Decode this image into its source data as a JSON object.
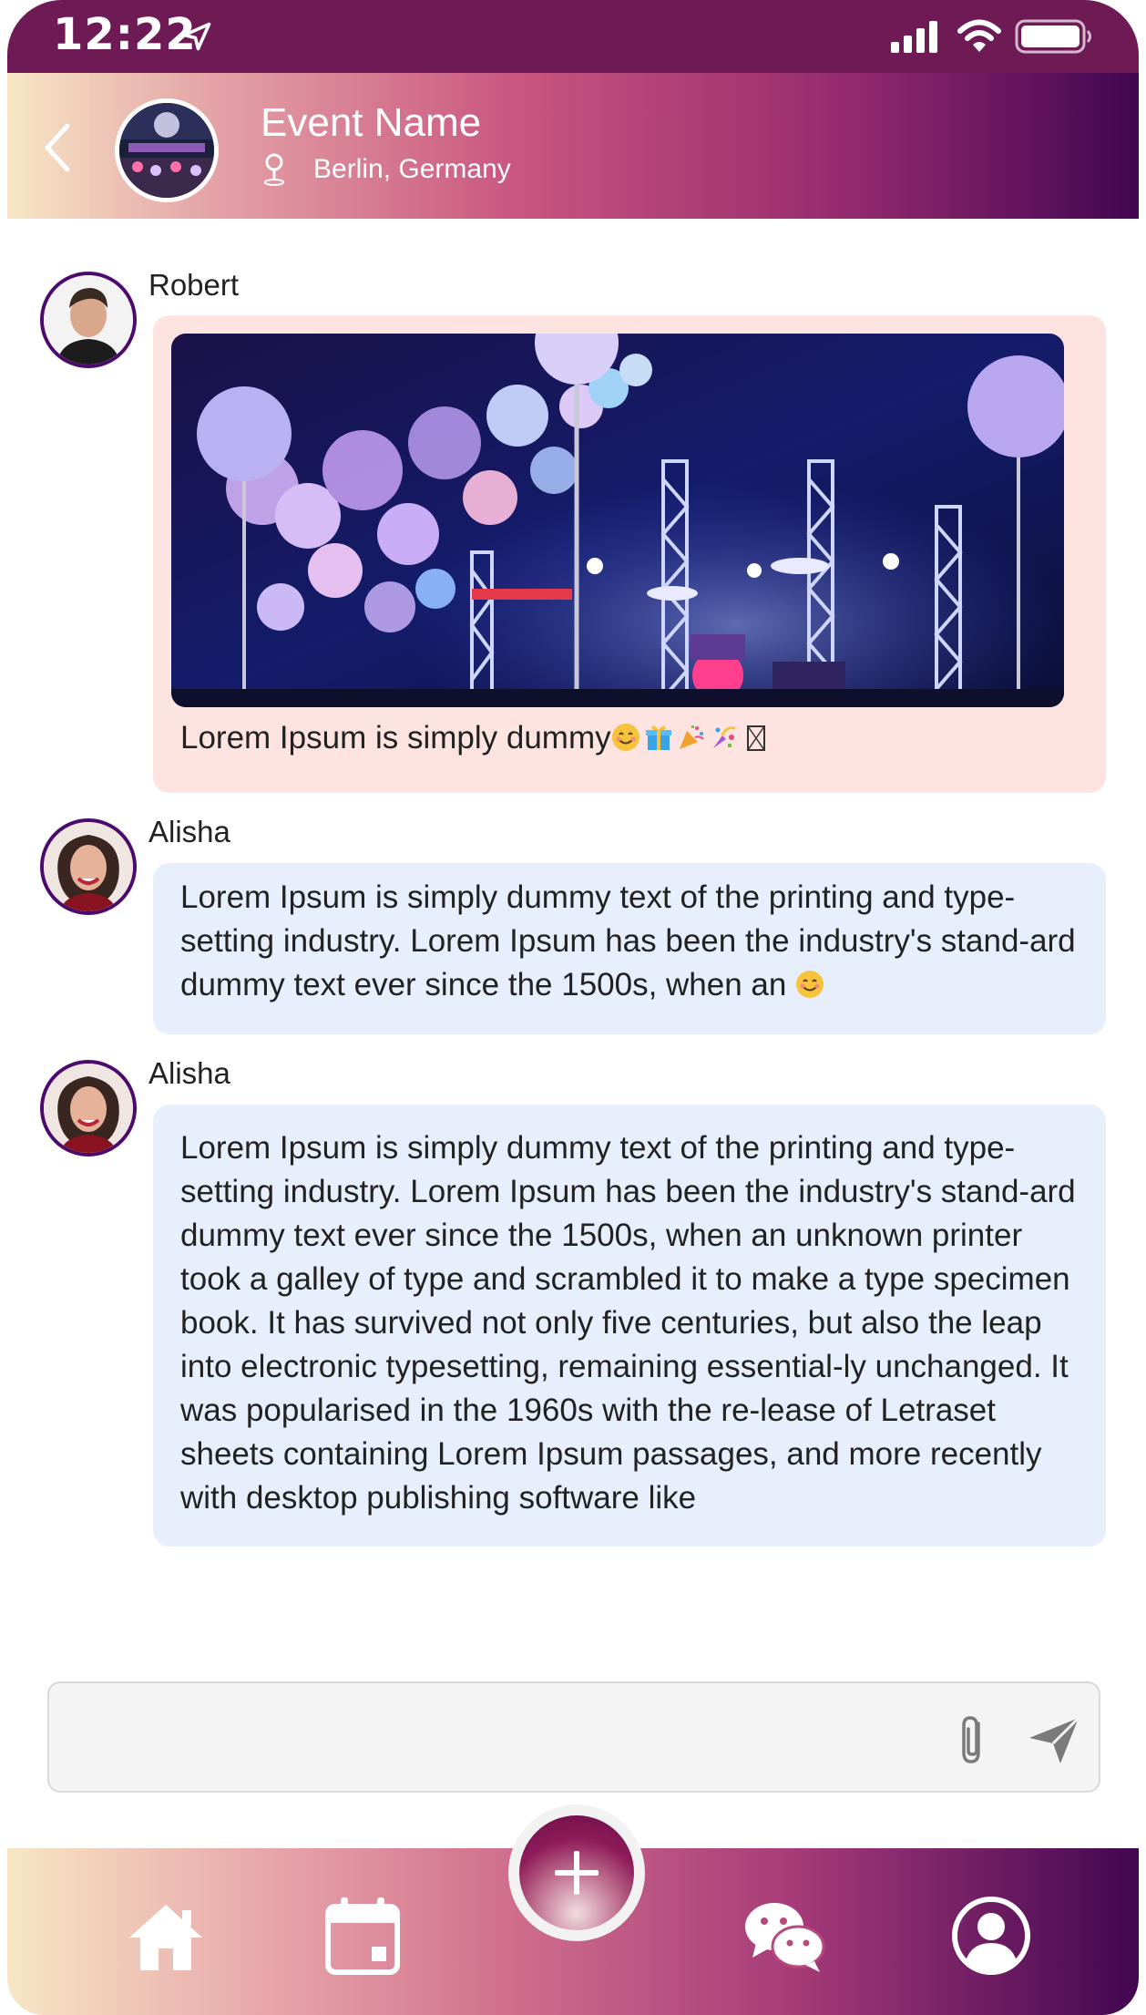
{
  "status_bar": {
    "time": "12:22"
  },
  "header": {
    "title": "Event Name",
    "location": "Berlin, Germany"
  },
  "messages": [
    {
      "sender": "Robert",
      "caption": "Lorem Ipsum is simply dummy"
    },
    {
      "sender": "Alisha",
      "text": "Lorem Ipsum is simply dummy text of the printing and type-setting industry. Lorem Ipsum has been the industry's stand-ard dummy text ever since the 1500s, when an"
    },
    {
      "sender": "Alisha",
      "text": "Lorem Ipsum is simply dummy text of the printing and type-setting industry. Lorem Ipsum has been the industry's stand-ard dummy text ever since the 1500s, when an unknown printer took a galley of type and scrambled it to make a type specimen book. It has survived not only five centuries, but also the leap into electronic typesetting, remaining essential-ly unchanged. It was popularised in the 1960s with the re-lease of Letraset sheets containing Lorem Ipsum passages, and more recently with desktop publishing software like"
    }
  ],
  "composer": {
    "placeholder": ""
  },
  "bottom_nav": {
    "items": [
      "home-icon",
      "calendar-icon",
      "add-icon",
      "chat-icon",
      "profile-icon"
    ]
  },
  "colors": {
    "header_gradient_start": "#f7e6c5",
    "header_gradient_end": "#420651",
    "avatar_border": "#4c0a6c",
    "pink_bubble": "#fde4e1",
    "blue_bubble": "#e7eefc"
  }
}
